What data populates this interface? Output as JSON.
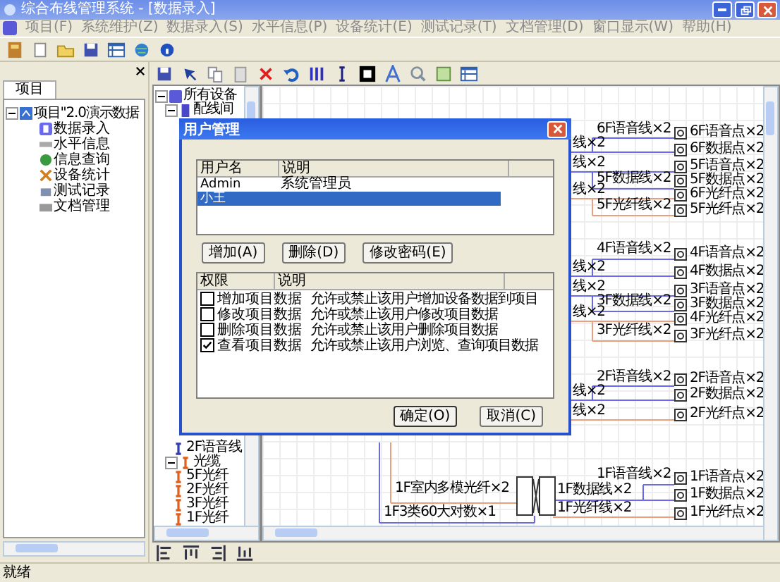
{
  "window": {
    "title": "综合布线管理系统 - [数据录入]"
  },
  "menu": [
    "项目(F)",
    "系统维护(Z)",
    "数据录入(S)",
    "水平信息(P)",
    "设备统计(E)",
    "测试记录(T)",
    "文档管理(D)",
    "窗口显示(W)",
    "帮助(H)"
  ],
  "project_panel": {
    "tab": {
      "label": "项目",
      "selected": true
    },
    "tree": [
      {
        "label": "项目\"2.0演示数据",
        "expanded": true,
        "children": [
          {
            "label": "数据录入"
          },
          {
            "label": "水平信息"
          },
          {
            "label": "信息查询"
          },
          {
            "label": "设备统计"
          },
          {
            "label": "测试记录"
          },
          {
            "label": "文档管理"
          }
        ]
      }
    ]
  },
  "device_tree": [
    {
      "label": "所有设备",
      "expanded": true,
      "children": [
        {
          "label": "配线间",
          "expanded": true,
          "children": [
            {
              "label": "2F语音线"
            }
          ]
        },
        {
          "label": "光缆",
          "expanded": true,
          "children": [
            {
              "label": "5F光纤"
            },
            {
              "label": "2F光纤"
            },
            {
              "label": "3F光纤"
            },
            {
              "label": "1F光纤"
            }
          ]
        }
      ]
    }
  ],
  "diagram": {
    "cut_labels": [
      "线×2",
      "线×2",
      "线×2",
      "线×2",
      "线×2",
      "线×2",
      "线×2",
      "线×2"
    ],
    "cables": [
      "6F语音线×2",
      "5F数据线×2",
      "5F光纤线×2",
      "4F语音线×2",
      "3F数据线×2",
      "3F光纤线×2",
      "2F语音线×2",
      "1F语音线×2",
      "1F数据线×2",
      "1F光纤线×2",
      "1F室内多模光纤×2",
      "1F3类60大对数×1"
    ],
    "points": [
      "6F语音点×2",
      "6F数据点×2",
      "5F语音点×2",
      "5F数据点×2",
      "6F光纤点×2",
      "5F光纤点×2",
      "4F语音点×2",
      "4F数据点×2",
      "3F语音点×2",
      "3F数据点×2",
      "4F光纤点×2",
      "3F光纤点×2",
      "2F语音点×2",
      "2F数据点×2",
      "2F光纤点×2",
      "1F语音点×2",
      "1F数据点×2",
      "1F光纤点×2"
    ]
  },
  "dialog": {
    "title": "用户管理",
    "user_columns": [
      "用户名",
      "说明"
    ],
    "users": [
      {
        "name": "Admin",
        "description": "系统管理员",
        "selected": false
      },
      {
        "name": "小王",
        "selected": true
      }
    ],
    "user_buttons": [
      "增加(A)",
      "删除(D)",
      "修改密码(E)"
    ],
    "permission_columns": [
      "权限",
      "说明"
    ],
    "permissions": [
      {
        "name": "增加项目数据",
        "description": "允许或禁止该用户增加设备数据到项目",
        "checked": false
      },
      {
        "name": "修改项目数据",
        "description": "允许或禁止该用户修改项目数据",
        "checked": false
      },
      {
        "name": "删除项目数据",
        "description": "允许或禁止该用户删除项目数据",
        "checked": false
      },
      {
        "name": "查看项目数据",
        "description": "允许或禁止该用户浏览、查询项目数据",
        "checked": true
      }
    ],
    "buttons": [
      "确定(O)",
      "取消(C)"
    ]
  },
  "status_bar": "就绪"
}
